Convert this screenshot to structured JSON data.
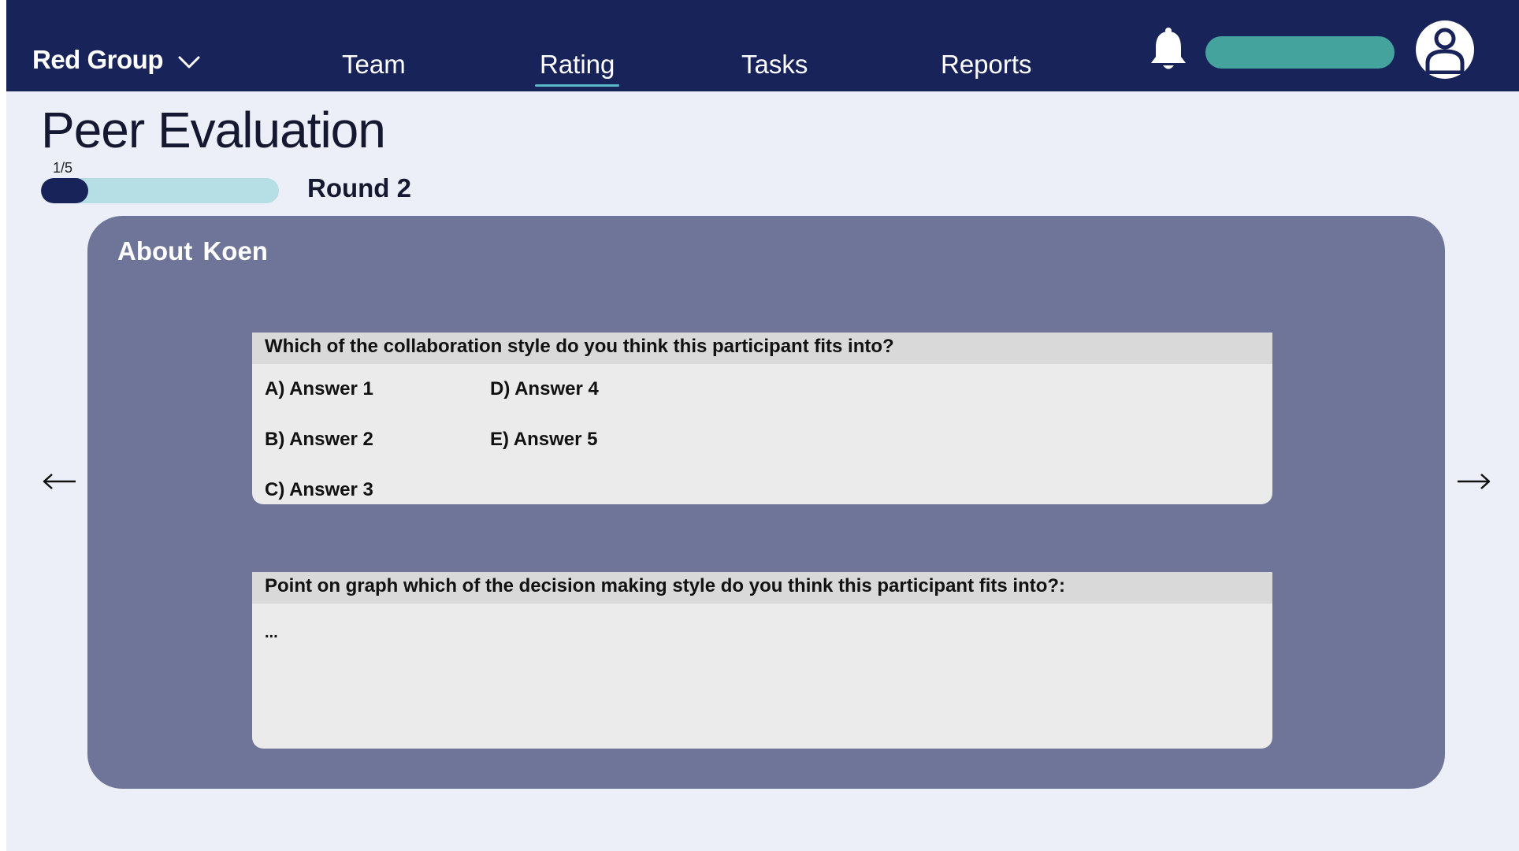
{
  "header": {
    "group_name": "Red Group",
    "tabs": [
      {
        "label": "Team",
        "active": false
      },
      {
        "label": "Rating",
        "active": true
      },
      {
        "label": "Tasks",
        "active": false
      },
      {
        "label": "Reports",
        "active": false
      }
    ],
    "icons": {
      "group_dropdown": "chevron-down-icon",
      "notifications": "bell-icon",
      "profile": "user-icon"
    },
    "colors": {
      "bar": "#18235a",
      "accent_pill": "#44a39d",
      "active_underline": "#5ab8c9"
    }
  },
  "page": {
    "title": "Peer Evaluation",
    "progress": {
      "label": "1/5",
      "current": 1,
      "total": 5
    },
    "round_label": "Round 2"
  },
  "card": {
    "title": "About  Koen",
    "question1": {
      "text": "Which of the collaboration style do you think this participant fits into?",
      "answers": [
        "A) Answer 1",
        "B) Answer 2",
        "C) Answer 3",
        "D) Answer 4",
        "E) Answer 5"
      ]
    },
    "question2": {
      "text": "Point on graph which of the decision making style do you think this participant fits into?:",
      "value": "..."
    },
    "nav": {
      "prev_icon": "arrow-left-icon",
      "next_icon": "arrow-right-icon"
    }
  }
}
